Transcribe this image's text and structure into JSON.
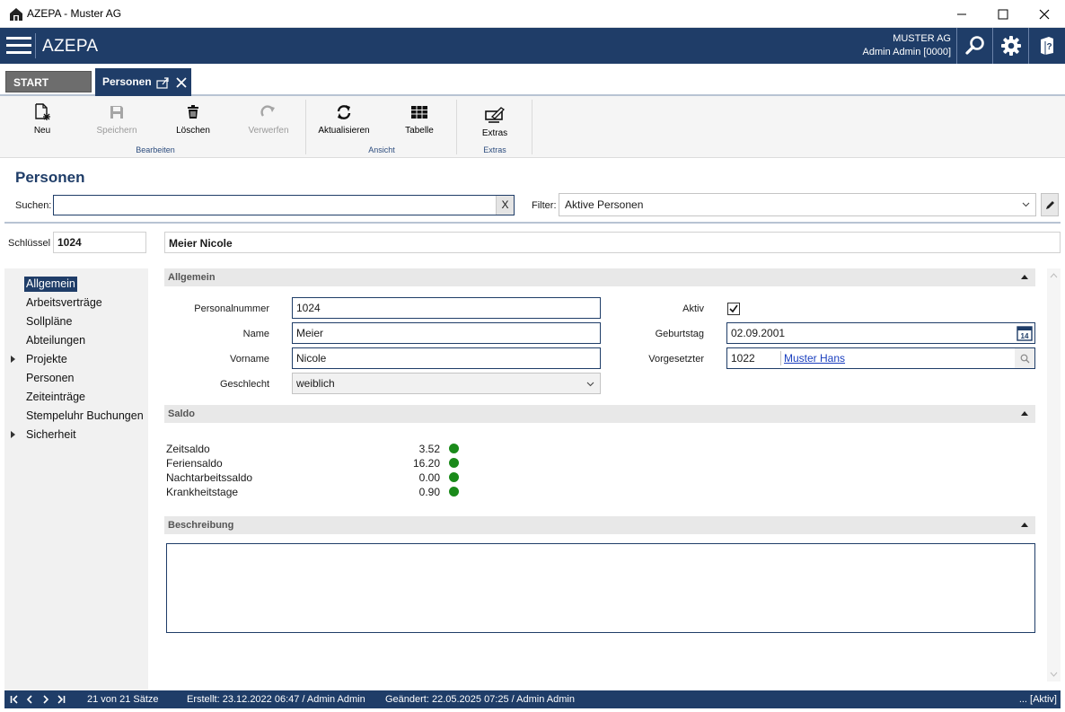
{
  "window": {
    "title": "AZEPA - Muster AG"
  },
  "header": {
    "brand": "AZEPA",
    "company": "MUSTER AG",
    "user": "Admin Admin [0000]"
  },
  "tabs": {
    "start": "START",
    "personen": "Personen"
  },
  "ribbon": {
    "neu": "Neu",
    "speichern": "Speichern",
    "loeschen": "Löschen",
    "verwerfen": "Verwerfen",
    "aktualisieren": "Aktualisieren",
    "tabelle": "Tabelle",
    "extras": "Extras",
    "group_bearbeiten": "Bearbeiten",
    "group_ansicht": "Ansicht",
    "group_extras": "Extras"
  },
  "search": {
    "page_title": "Personen",
    "label": "Suchen:",
    "value": "",
    "clear": "X",
    "filter_label": "Filter:",
    "filter_value": "Aktive Personen"
  },
  "record": {
    "key_label": "Schlüssel",
    "key": "1024",
    "display_name": "Meier Nicole"
  },
  "nav": {
    "items": [
      {
        "label": "Allgemein"
      },
      {
        "label": "Arbeitsverträge"
      },
      {
        "label": "Sollpläne"
      },
      {
        "label": "Abteilungen"
      },
      {
        "label": "Projekte"
      },
      {
        "label": "Personen"
      },
      {
        "label": "Zeiteinträge"
      },
      {
        "label": "Stempeluhr Buchungen"
      },
      {
        "label": "Sicherheit"
      }
    ]
  },
  "allgemein": {
    "title": "Allgemein",
    "personalnummer_label": "Personalnummer",
    "personalnummer": "1024",
    "name_label": "Name",
    "name": "Meier",
    "vorname_label": "Vorname",
    "vorname": "Nicole",
    "geschlecht_label": "Geschlecht",
    "geschlecht": "weiblich",
    "aktiv_label": "Aktiv",
    "geburtstag_label": "Geburtstag",
    "geburtstag": "02.09.2001",
    "calendar_day": "14",
    "vorgesetzter_label": "Vorgesetzter",
    "vorgesetzter_id": "1022",
    "vorgesetzter_name": "Muster Hans"
  },
  "saldo": {
    "title": "Saldo",
    "rows": [
      {
        "label": "Zeitsaldo",
        "value": "3.52"
      },
      {
        "label": "Feriensaldo",
        "value": "16.20"
      },
      {
        "label": "Nachtarbeitssaldo",
        "value": "0.00"
      },
      {
        "label": "Krankheitstage",
        "value": "0.90"
      }
    ]
  },
  "beschreibung": {
    "title": "Beschreibung",
    "text": ""
  },
  "status": {
    "count": "21 von 21 Sätze",
    "created": "Erstellt: 23.12.2022 06:47 / Admin Admin",
    "changed": "Geändert: 22.05.2025 07:25 / Admin Admin",
    "state": "... [Aktiv]"
  },
  "colors": {
    "primary": "#1f3d68",
    "status_ok": "#1a8a1a"
  }
}
